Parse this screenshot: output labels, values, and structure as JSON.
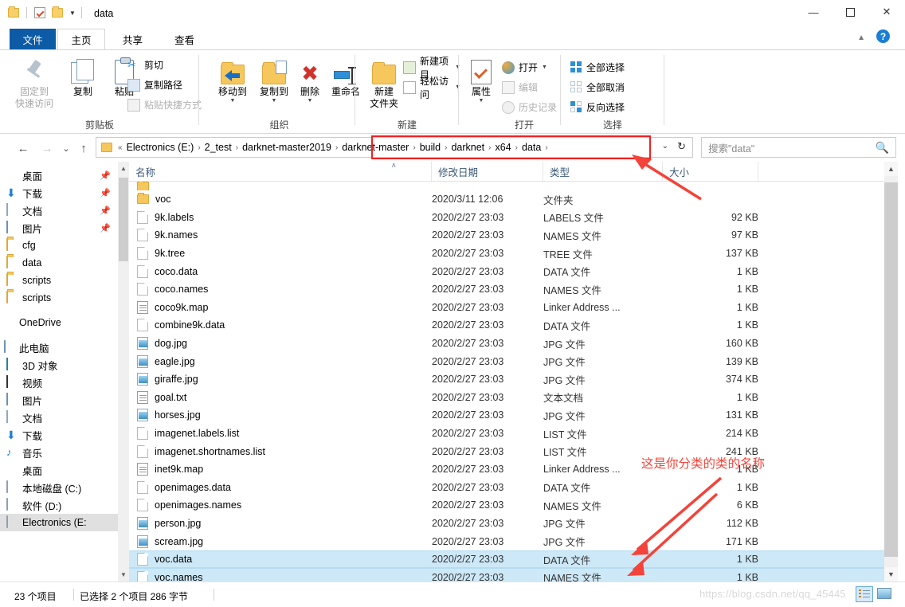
{
  "window": {
    "title": "data",
    "quick_access": {
      "folder_icon": "folder-icon",
      "check_icon": "checkmark-properties-icon",
      "dropdown_icon": "chevron-down-icon"
    },
    "controls": {
      "minimize": "—",
      "maximize": "☐",
      "close": "✕"
    },
    "ribbon_collapse_icon": "chevron-up-icon",
    "help_label": "?"
  },
  "tabs": [
    {
      "label": "文件",
      "name": "tab-file"
    },
    {
      "label": "主页",
      "name": "tab-home"
    },
    {
      "label": "共享",
      "name": "tab-share"
    },
    {
      "label": "查看",
      "name": "tab-view"
    }
  ],
  "ribbon": {
    "clipboard": {
      "group_label": "剪贴板",
      "pin": "固定到\n快速访问",
      "pin_line1": "固定到",
      "pin_line2": "快速访问",
      "copy": "复制",
      "paste": "粘贴",
      "cut": "剪切",
      "copy_path": "复制路径",
      "paste_shortcut": "粘贴快捷方式"
    },
    "organize": {
      "group_label": "组织",
      "move_to": "移动到",
      "copy_to": "复制到",
      "delete": "删除",
      "rename": "重命名"
    },
    "new": {
      "group_label": "新建",
      "new_folder_line1": "新建",
      "new_folder_line2": "文件夹",
      "new_item": "新建项目",
      "easy_access": "轻松访问"
    },
    "open": {
      "group_label": "打开",
      "properties": "属性",
      "open": "打开",
      "edit": "编辑",
      "history": "历史记录"
    },
    "select": {
      "group_label": "选择",
      "select_all": "全部选择",
      "select_none": "全部取消",
      "invert": "反向选择"
    }
  },
  "address": {
    "back_icon": "←",
    "forward_icon": "→",
    "recent_icon": "⌄",
    "up_icon": "↑",
    "folder_icon": "folder-icon",
    "overflow": "«",
    "crumbs_before": [
      "Electronics (E:)",
      "2_test",
      "darknet-master2019"
    ],
    "crumbs_highlighted": [
      "darknet-master",
      "build",
      "darknet",
      "x64",
      "data"
    ],
    "separator": "›",
    "dropdown_icon": "⌄",
    "refresh_icon": "↻"
  },
  "search": {
    "placeholder": "搜索\"data\"",
    "icon": "search-icon"
  },
  "sidebar": {
    "quick_access": [
      {
        "label": "桌面",
        "icon": "desktop-icon",
        "pinned": true
      },
      {
        "label": "下载",
        "icon": "downloads-icon",
        "pinned": true
      },
      {
        "label": "文档",
        "icon": "documents-icon",
        "pinned": true
      },
      {
        "label": "图片",
        "icon": "pictures-icon",
        "pinned": true
      },
      {
        "label": "cfg",
        "icon": "folder-icon",
        "pinned": false
      },
      {
        "label": "data",
        "icon": "folder-icon",
        "pinned": false
      },
      {
        "label": "scripts",
        "icon": "folder-icon",
        "pinned": false
      },
      {
        "label": "scripts",
        "icon": "folder-icon",
        "pinned": false
      }
    ],
    "onedrive": {
      "label": "OneDrive",
      "icon": "onedrive-cloud-icon"
    },
    "this_pc": {
      "label": "此电脑",
      "icon": "this-pc-icon"
    },
    "pc_items": [
      {
        "label": "3D 对象",
        "icon": "3d-objects-icon"
      },
      {
        "label": "视频",
        "icon": "videos-icon"
      },
      {
        "label": "图片",
        "icon": "pictures-icon"
      },
      {
        "label": "文档",
        "icon": "documents-icon"
      },
      {
        "label": "下载",
        "icon": "downloads-icon"
      },
      {
        "label": "音乐",
        "icon": "music-icon"
      },
      {
        "label": "桌面",
        "icon": "desktop-icon"
      },
      {
        "label": "本地磁盘 (C:)",
        "icon": "disk-icon"
      },
      {
        "label": "软件 (D:)",
        "icon": "disk-icon"
      },
      {
        "label": "Electronics (E:",
        "icon": "disk-icon",
        "selected": true
      }
    ]
  },
  "filelist": {
    "columns": [
      {
        "label": "名称",
        "name": "column-name"
      },
      {
        "label": "修改日期",
        "name": "column-date"
      },
      {
        "label": "类型",
        "name": "column-type"
      },
      {
        "label": "大小",
        "name": "column-size"
      }
    ],
    "sort_indicator": "ʌ",
    "rows": [
      {
        "name": "",
        "date": "",
        "type": "",
        "size": "",
        "icon": "folder-icon",
        "clipped": true,
        "selected": false
      },
      {
        "name": "voc",
        "date": "2020/3/11 12:06",
        "type": "文件夹",
        "size": "",
        "icon": "folder-icon",
        "selected": false
      },
      {
        "name": "9k.labels",
        "date": "2020/2/27 23:03",
        "type": "LABELS 文件",
        "size": "92 KB",
        "icon": "file-icon",
        "selected": false
      },
      {
        "name": "9k.names",
        "date": "2020/2/27 23:03",
        "type": "NAMES 文件",
        "size": "97 KB",
        "icon": "file-icon",
        "selected": false
      },
      {
        "name": "9k.tree",
        "date": "2020/2/27 23:03",
        "type": "TREE 文件",
        "size": "137 KB",
        "icon": "file-icon",
        "selected": false
      },
      {
        "name": "coco.data",
        "date": "2020/2/27 23:03",
        "type": "DATA 文件",
        "size": "1 KB",
        "icon": "file-icon",
        "selected": false
      },
      {
        "name": "coco.names",
        "date": "2020/2/27 23:03",
        "type": "NAMES 文件",
        "size": "1 KB",
        "icon": "file-icon",
        "selected": false
      },
      {
        "name": "coco9k.map",
        "date": "2020/2/27 23:03",
        "type": "Linker Address ...",
        "size": "1 KB",
        "icon": "text-icon",
        "selected": false
      },
      {
        "name": "combine9k.data",
        "date": "2020/2/27 23:03",
        "type": "DATA 文件",
        "size": "1 KB",
        "icon": "file-icon",
        "selected": false
      },
      {
        "name": "dog.jpg",
        "date": "2020/2/27 23:03",
        "type": "JPG 文件",
        "size": "160 KB",
        "icon": "image-icon",
        "selected": false
      },
      {
        "name": "eagle.jpg",
        "date": "2020/2/27 23:03",
        "type": "JPG 文件",
        "size": "139 KB",
        "icon": "image-icon",
        "selected": false
      },
      {
        "name": "giraffe.jpg",
        "date": "2020/2/27 23:03",
        "type": "JPG 文件",
        "size": "374 KB",
        "icon": "image-icon",
        "selected": false
      },
      {
        "name": "goal.txt",
        "date": "2020/2/27 23:03",
        "type": "文本文档",
        "size": "1 KB",
        "icon": "text-icon",
        "selected": false
      },
      {
        "name": "horses.jpg",
        "date": "2020/2/27 23:03",
        "type": "JPG 文件",
        "size": "131 KB",
        "icon": "image-icon",
        "selected": false
      },
      {
        "name": "imagenet.labels.list",
        "date": "2020/2/27 23:03",
        "type": "LIST 文件",
        "size": "214 KB",
        "icon": "file-icon",
        "selected": false
      },
      {
        "name": "imagenet.shortnames.list",
        "date": "2020/2/27 23:03",
        "type": "LIST 文件",
        "size": "241 KB",
        "icon": "file-icon",
        "selected": false
      },
      {
        "name": "inet9k.map",
        "date": "2020/2/27 23:03",
        "type": "Linker Address ...",
        "size": "1 KB",
        "icon": "text-icon",
        "selected": false
      },
      {
        "name": "openimages.data",
        "date": "2020/2/27 23:03",
        "type": "DATA 文件",
        "size": "1 KB",
        "icon": "file-icon",
        "selected": false
      },
      {
        "name": "openimages.names",
        "date": "2020/2/27 23:03",
        "type": "NAMES 文件",
        "size": "6 KB",
        "icon": "file-icon",
        "selected": false
      },
      {
        "name": "person.jpg",
        "date": "2020/2/27 23:03",
        "type": "JPG 文件",
        "size": "112 KB",
        "icon": "image-icon",
        "selected": false
      },
      {
        "name": "scream.jpg",
        "date": "2020/2/27 23:03",
        "type": "JPG 文件",
        "size": "171 KB",
        "icon": "image-icon",
        "selected": false
      },
      {
        "name": "voc.data",
        "date": "2020/2/27 23:03",
        "type": "DATA 文件",
        "size": "1 KB",
        "icon": "file-icon",
        "selected": true
      },
      {
        "name": "voc.names",
        "date": "2020/2/27 23:03",
        "type": "NAMES 文件",
        "size": "1 KB",
        "icon": "file-icon",
        "selected": true
      }
    ]
  },
  "status": {
    "item_count": "23 个项目",
    "selection": "已选择 2 个项目  286 字节"
  },
  "watermark": "https://blog.csdn.net/qq_45445",
  "annotation": {
    "text": "这是你分类的类的名称",
    "color": "#f4433a",
    "box_color": "#ee2222"
  },
  "view_buttons": {
    "details": "details-view-icon",
    "large_icons": "large-icons-view-icon"
  }
}
